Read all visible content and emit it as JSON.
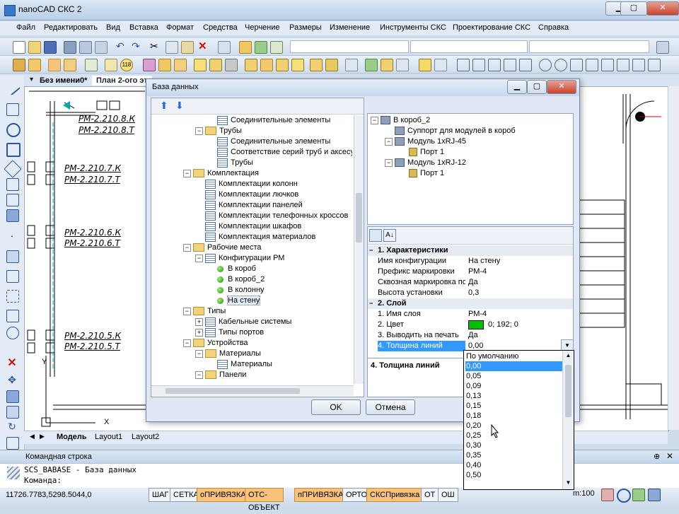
{
  "window": {
    "title": "nanoCAD СКС 2",
    "min": "▁",
    "max": "▢",
    "close": "✕"
  },
  "menu": [
    "Файл",
    "Редактировать",
    "Вид",
    "Вставка",
    "Формат",
    "Средства",
    "Черчение",
    "Размеры",
    "Изменение",
    "Инструменты СКС",
    "Проектирование СКС",
    "Справка"
  ],
  "doc_tabs": [
    "Без имени0*",
    "План 2-ого эт"
  ],
  "drawing": {
    "labels": [
      "РМ-2.210.8.К",
      "РМ-2.210.8.Т",
      "РМ-2.210.7.К",
      "РМ-2.210.7.Т",
      "РМ-2.210.6.К",
      "РМ-2.210.6.Т",
      "РМ-2.210.5.К",
      "РМ-2.210.5.Т"
    ],
    "axis_y": "Y",
    "axis_x": "X"
  },
  "layout_tabs": [
    "Модель",
    "Layout1",
    "Layout2"
  ],
  "cmd": {
    "title": "Командная строка",
    "line1": "SCS_BABASE - База данных",
    "line2": "Команда:"
  },
  "status": {
    "coords": "11726.7783,5298.5044,0",
    "buttons": [
      "ШАГ",
      "СЕТКА",
      "оПРИВЯЗКА",
      "ОТС-ОБЪЕКТ",
      "пПРИВЯЗКА",
      "ОРТО",
      "СКСПривязка",
      "ОТ",
      "ОШ"
    ],
    "active": [
      false,
      false,
      true,
      true,
      true,
      false,
      true,
      false,
      false
    ],
    "scale": "m:100"
  },
  "dialog": {
    "title": "База данных",
    "left_tree": [
      {
        "level": 3,
        "icon": "table",
        "label": "Соединительные элементы"
      },
      {
        "level": 2,
        "icon": "folder",
        "toggle": "−",
        "label": "Трубы"
      },
      {
        "level": 3,
        "icon": "table",
        "label": "Соединительные элементы"
      },
      {
        "level": 3,
        "icon": "table",
        "label": "Соответствие серий труб и аксесуаров"
      },
      {
        "level": 3,
        "icon": "table",
        "label": "Трубы"
      },
      {
        "level": 1,
        "icon": "folder",
        "toggle": "−",
        "label": "Комплектация"
      },
      {
        "level": 2,
        "icon": "table",
        "label": "Комплектации колонн"
      },
      {
        "level": 2,
        "icon": "table",
        "label": "Комплектации лючков"
      },
      {
        "level": 2,
        "icon": "table",
        "label": "Комплектации панелей"
      },
      {
        "level": 2,
        "icon": "table",
        "label": "Комплектации телефонных кроссов"
      },
      {
        "level": 2,
        "icon": "table",
        "label": "Комплектации шкафов"
      },
      {
        "level": 2,
        "icon": "table",
        "label": "Комплектация материалов"
      },
      {
        "level": 1,
        "icon": "folder",
        "toggle": "−",
        "label": "Рабочие места"
      },
      {
        "level": 2,
        "icon": "table",
        "toggle": "−",
        "label": "Конфигурации РМ"
      },
      {
        "level": 3,
        "icon": "dot",
        "label": "В короб"
      },
      {
        "level": 3,
        "icon": "dot",
        "label": "В короб_2"
      },
      {
        "level": 3,
        "icon": "dot",
        "label": "В колонну"
      },
      {
        "level": 3,
        "icon": "dot",
        "label": "На стену",
        "selected": true
      },
      {
        "level": 1,
        "icon": "folder",
        "toggle": "−",
        "label": "Типы"
      },
      {
        "level": 2,
        "icon": "table",
        "toggle": "+",
        "label": "Кабельные системы"
      },
      {
        "level": 2,
        "icon": "table",
        "toggle": "+",
        "label": "Типы портов"
      },
      {
        "level": 1,
        "icon": "folder",
        "toggle": "−",
        "label": "Устройства"
      },
      {
        "level": 2,
        "icon": "folder",
        "toggle": "−",
        "label": "Материалы"
      },
      {
        "level": 3,
        "icon": "table",
        "label": "Материалы"
      },
      {
        "level": 2,
        "icon": "folder",
        "toggle": "−",
        "label": "Панели"
      }
    ],
    "right_tree": [
      {
        "level": 0,
        "icon": "box",
        "toggle": "−",
        "label": "В короб_2"
      },
      {
        "level": 1,
        "icon": "box",
        "label": "Суппорт для модулей в короб"
      },
      {
        "level": 1,
        "icon": "box",
        "toggle": "−",
        "label": "Модуль  1xRJ-45"
      },
      {
        "level": 2,
        "icon": "port",
        "label": "Порт 1"
      },
      {
        "level": 1,
        "icon": "box",
        "toggle": "−",
        "label": "Модуль  1xRJ-12"
      },
      {
        "level": 2,
        "icon": "port",
        "label": "Порт 1"
      }
    ],
    "props": [
      {
        "cat": true,
        "name": "1. Характеристики"
      },
      {
        "name": "Имя конфигурации",
        "value": "На стену"
      },
      {
        "name": "Префикс маркировки",
        "value": "РМ-4"
      },
      {
        "name": "Сквозная маркировка по",
        "value": "Да"
      },
      {
        "name": "Высота установки",
        "value": "0,3"
      },
      {
        "cat": true,
        "name": "2. Слой"
      },
      {
        "name": "1. Имя слоя",
        "value": "РМ-4"
      },
      {
        "name": "2. Цвет",
        "value": "0; 192; 0",
        "swatch": "#00c000"
      },
      {
        "name": "3. Выводить на печать",
        "value": "Да"
      },
      {
        "name": "4. Толщина линий",
        "value": "0,00",
        "selected": true
      }
    ],
    "desc": "4. Толщина линий",
    "ok": "OK",
    "cancel": "Отмена"
  },
  "dropdown": [
    "По умолчанию",
    "0,00",
    "0,05",
    "0,09",
    "0,13",
    "0,15",
    "0,18",
    "0,20",
    "0,25",
    "0,30",
    "0,35",
    "0,40",
    "0,50"
  ],
  "dropdown_selected": 1,
  "colors": {
    "accent": "#3399ff",
    "status_on": "#f7c37a",
    "layer_green": "#00c000"
  }
}
